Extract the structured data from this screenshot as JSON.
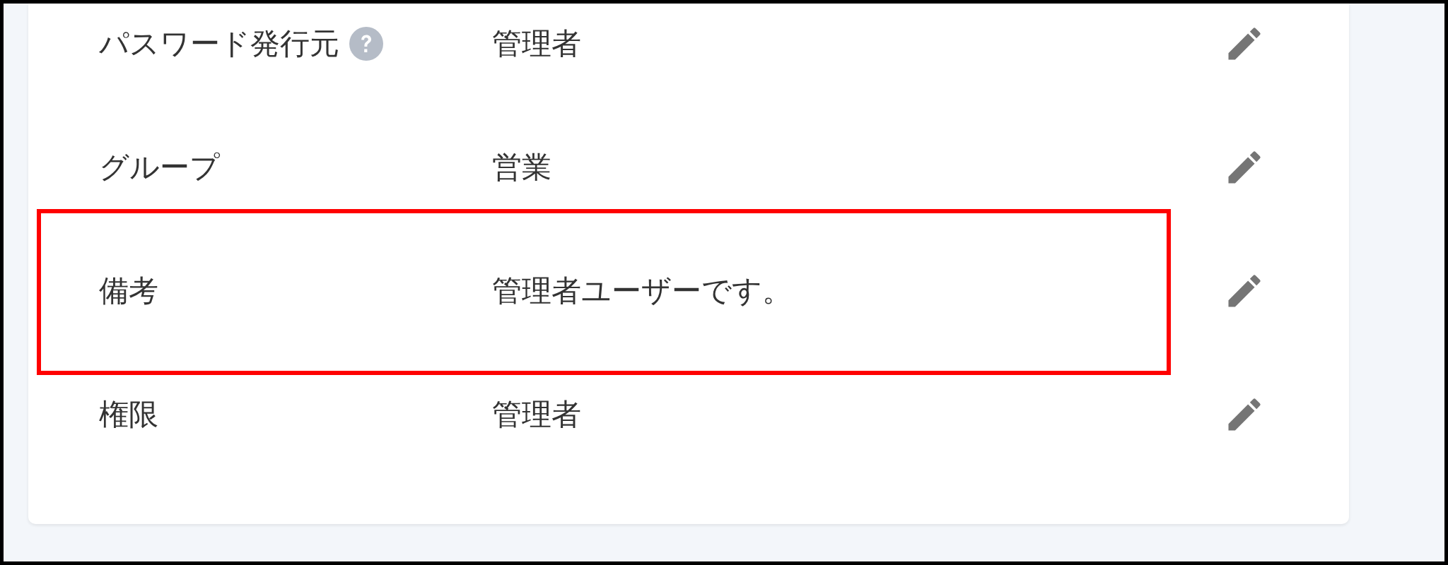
{
  "rows": [
    {
      "label": "パスワード発行元",
      "help": true,
      "value": "管理者",
      "highlighted": false
    },
    {
      "label": "グループ",
      "help": false,
      "value": "営業",
      "highlighted": false
    },
    {
      "label": "備考",
      "help": false,
      "value": "管理者ユーザーです。",
      "highlighted": true
    },
    {
      "label": "権限",
      "help": false,
      "value": "管理者",
      "highlighted": false
    }
  ]
}
